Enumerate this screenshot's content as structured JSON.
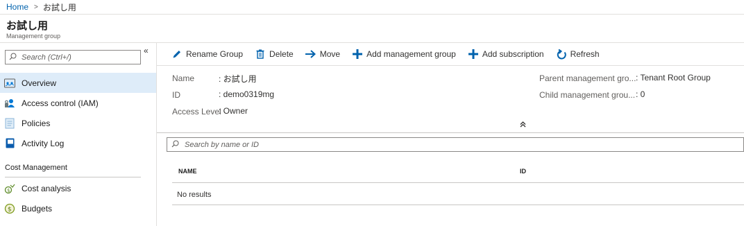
{
  "breadcrumb": {
    "home": "Home",
    "current": "お試し用"
  },
  "header": {
    "title": "お試し用",
    "subtitle": "Management group"
  },
  "sidebar": {
    "search_placeholder": "Search (Ctrl+/)",
    "collapse_glyph": "«",
    "items": [
      {
        "label": "Overview",
        "icon": "overview-icon",
        "active": true
      },
      {
        "label": "Access control (IAM)",
        "icon": "iam-icon"
      },
      {
        "label": "Policies",
        "icon": "policies-icon"
      },
      {
        "label": "Activity Log",
        "icon": "activity-log-icon"
      }
    ],
    "section": "Cost Management",
    "cost_items": [
      {
        "label": "Cost analysis",
        "icon": "cost-analysis-icon"
      },
      {
        "label": "Budgets",
        "icon": "budgets-icon"
      }
    ]
  },
  "toolbar": {
    "rename": "Rename Group",
    "delete": "Delete",
    "move": "Move",
    "add_mg": "Add management group",
    "add_sub": "Add subscription",
    "refresh": "Refresh"
  },
  "essentials": {
    "name_label": "Name",
    "name_value": ": お試し用",
    "id_label": "ID",
    "id_value": ": demo0319mg",
    "access_label": "Access Level",
    "access_value": ": Owner",
    "parent_label": "Parent management gro...",
    "parent_value": ": Tenant Root Group",
    "child_label": "Child management grou...",
    "child_value": ": 0",
    "collapse_glyph": "⌃"
  },
  "filter": {
    "placeholder": "Search by name or ID"
  },
  "grid": {
    "columns": [
      "NAME",
      "ID"
    ],
    "empty_text": "No results"
  },
  "colors": {
    "accent": "#0062ad",
    "active_bg": "#deecf9"
  }
}
